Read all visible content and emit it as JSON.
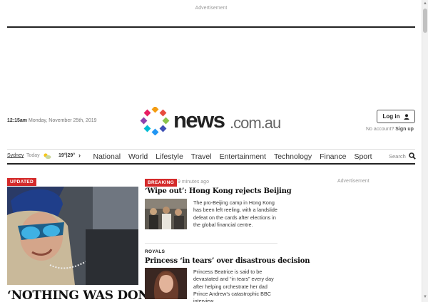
{
  "advertisement_top": "Advertisement",
  "advertisement_right": "Advertisement",
  "masthead": {
    "time": "12:15am",
    "date": "Monday, November 25th, 2019",
    "logo_news": "news",
    "logo_domain": ".com.au",
    "login_label": "Log in",
    "no_account_text": "No account?",
    "signup_label": "Sign up"
  },
  "nav": {
    "location": "Sydney",
    "today_label": "Today",
    "temps": "19°|29°",
    "items": [
      "National",
      "World",
      "Lifestyle",
      "Travel",
      "Entertainment",
      "Technology",
      "Finance",
      "Sport"
    ],
    "search_label": "Search"
  },
  "lead_story": {
    "badge": "UPDATED",
    "headline": "‘NOTHING WAS DONE’:"
  },
  "stories": [
    {
      "badge": "BREAKING",
      "time": "9 minutes ago",
      "headline": "‘Wipe out’: Hong Kong rejects Beijing",
      "summary": "The pro-Beijing camp in Hong Kong has been left reeling, with a landslide defeat on the cards after elections in the global financial centre."
    },
    {
      "kicker": "ROYALS",
      "headline": "Princess ‘in tears’ over disastrous decision",
      "summary": "Princess Beatrice is said to be devastated and “in tears” every day after helping orchestrate her dad Prince Andrew’s catastrophic BBC interview."
    }
  ],
  "colors": {
    "accent_red": "#d42a2a",
    "text": "#222222"
  }
}
